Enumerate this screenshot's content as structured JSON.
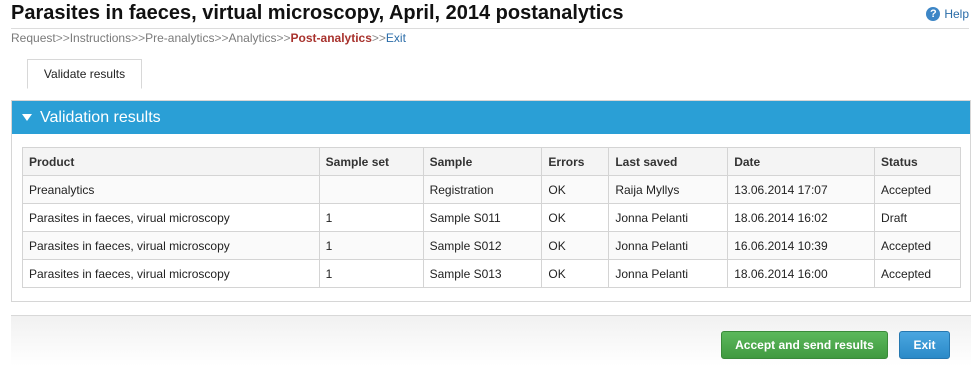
{
  "page": {
    "title": "Parasites in faeces, virtual microscopy, April, 2014 postanalytics",
    "help_label": "Help"
  },
  "breadcrumb": {
    "separator": ">>",
    "items": [
      {
        "label": "Request",
        "state": "done"
      },
      {
        "label": "Instructions",
        "state": "done"
      },
      {
        "label": "Pre-analytics",
        "state": "done"
      },
      {
        "label": "Analytics",
        "state": "done"
      },
      {
        "label": "Post-analytics",
        "state": "current"
      },
      {
        "label": "Exit",
        "state": "link"
      }
    ]
  },
  "tabs": [
    {
      "label": "Validate results",
      "active": true
    }
  ],
  "panel": {
    "title": "Validation results",
    "columns": [
      "Product",
      "Sample set",
      "Sample",
      "Errors",
      "Last saved",
      "Date",
      "Status"
    ],
    "rows": [
      {
        "product": "Preanalytics",
        "sample_set": "",
        "sample": "Registration",
        "errors": "OK",
        "last_saved": "Raija Myllys",
        "date": "13.06.2014 17:07",
        "status": "Accepted"
      },
      {
        "product": "Parasites in faeces, virual microscopy",
        "sample_set": "1",
        "sample": "Sample S011",
        "errors": "OK",
        "last_saved": "Jonna Pelanti",
        "date": "18.06.2014 16:02",
        "status": "Draft"
      },
      {
        "product": "Parasites in faeces, virual microscopy",
        "sample_set": "1",
        "sample": "Sample S012",
        "errors": "OK",
        "last_saved": "Jonna Pelanti",
        "date": "16.06.2014 10:39",
        "status": "Accepted"
      },
      {
        "product": "Parasites in faeces, virual microscopy",
        "sample_set": "1",
        "sample": "Sample S013",
        "errors": "OK",
        "last_saved": "Jonna Pelanti",
        "date": "18.06.2014 16:00",
        "status": "Accepted"
      }
    ]
  },
  "footer": {
    "accept_label": "Accept and send results",
    "exit_label": "Exit"
  },
  "colors": {
    "panel_header": "#2a9fd6",
    "accept_button": "#4cae4c",
    "exit_button": "#3a98d6",
    "status_accepted": "#2a8a2a",
    "status_draft": "#c0302a",
    "breadcrumb_current": "#a8322d"
  },
  "icons": {
    "help": "help-circle-icon",
    "panel_toggle": "caret-down-icon"
  }
}
